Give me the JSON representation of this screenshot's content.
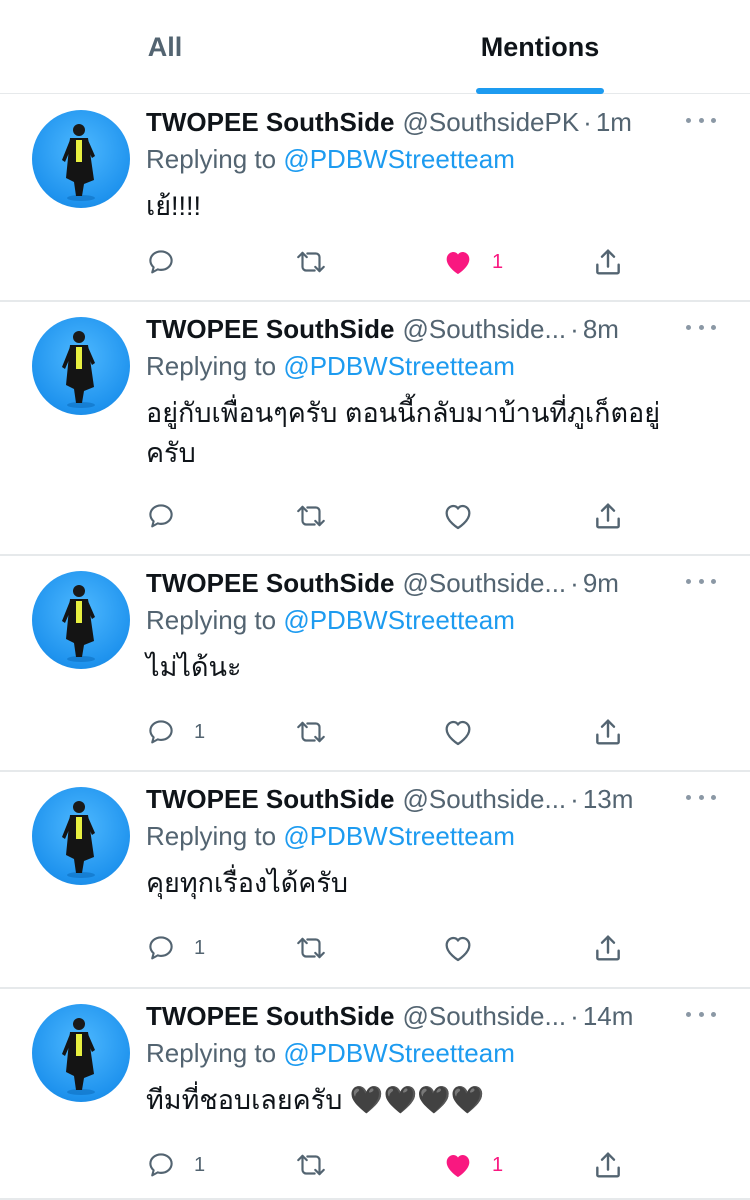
{
  "tabs": {
    "all": "All",
    "mentions": "Mentions"
  },
  "colors": {
    "accent": "#1d9bf0",
    "like": "#f91880",
    "muted": "#536471"
  },
  "icons": {
    "reply": "reply-icon",
    "retweet": "retweet-icon",
    "like": "heart-icon",
    "share": "share-icon",
    "more": "more-icon"
  },
  "tweets": [
    {
      "name": "TWOPEE SouthSide",
      "handle": "@SouthsidePK",
      "dot": "·",
      "time": "1m",
      "reply_prefix": "Replying to",
      "reply_to": "@PDBWStreetteam",
      "text": "เย้!!!!",
      "reply_count": "",
      "like_count": "1",
      "liked": true
    },
    {
      "name": "TWOPEE SouthSide",
      "handle": "@Southside...",
      "dot": "·",
      "time": "8m",
      "reply_prefix": "Replying to",
      "reply_to": "@PDBWStreetteam",
      "text": "อยู่กับเพื่อนๆครับ ตอนนี้กลับมาบ้านที่ภูเก็ตอยู่ครับ",
      "reply_count": "",
      "like_count": "",
      "liked": false
    },
    {
      "name": "TWOPEE SouthSide",
      "handle": "@Southside...",
      "dot": "·",
      "time": "9m",
      "reply_prefix": "Replying to",
      "reply_to": "@PDBWStreetteam",
      "text": "ไม่ได้นะ",
      "reply_count": "1",
      "like_count": "",
      "liked": false
    },
    {
      "name": "TWOPEE SouthSide",
      "handle": "@Southside...",
      "dot": "·",
      "time": "13m",
      "reply_prefix": "Replying to",
      "reply_to": "@PDBWStreetteam",
      "text": "คุยทุกเรื่องได้ครับ",
      "reply_count": "1",
      "like_count": "",
      "liked": false
    },
    {
      "name": "TWOPEE SouthSide",
      "handle": "@Southside...",
      "dot": "·",
      "time": "14m",
      "reply_prefix": "Replying to",
      "reply_to": "@PDBWStreetteam",
      "text": "ทีมที่ชอบเลยครับ 🖤🖤🖤🖤",
      "reply_count": "1",
      "like_count": "1",
      "liked": true
    }
  ]
}
